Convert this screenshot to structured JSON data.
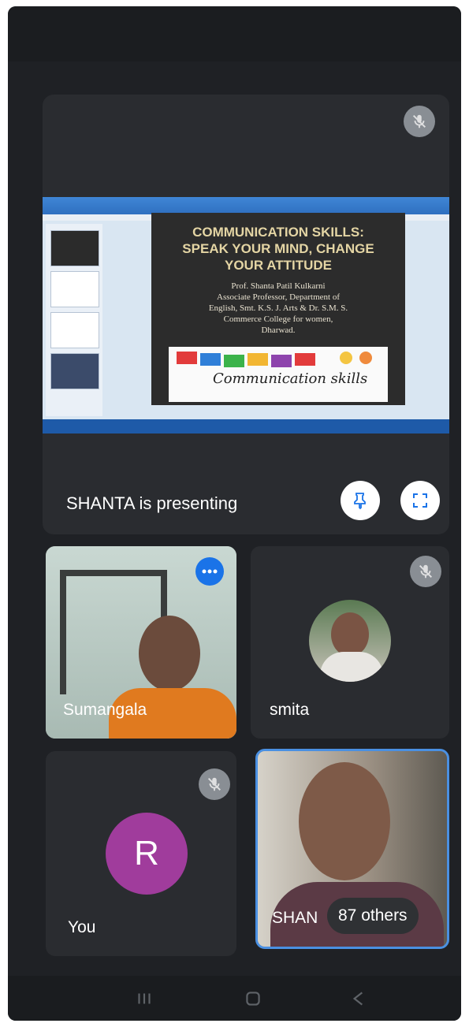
{
  "presentation": {
    "presenting_label": "SHANTA is presenting",
    "slide": {
      "title_line1": "COMMUNICATION SKILLS:",
      "title_line2": "SPEAK YOUR MIND, CHANGE",
      "title_line3": "YOUR ATTITUDE",
      "author": "Prof. Shanta Patil Kulkarni",
      "line1": "Associate Professor, Department of",
      "line2": "English, Smt. K.S. J. Arts & Dr. S.M. S.",
      "line3": "Commerce College for women,",
      "line4": "Dharwad.",
      "image_caption": "Communication skills"
    }
  },
  "participants": {
    "sumangala": {
      "name": "Sumangala"
    },
    "smita": {
      "name": "smita"
    },
    "you": {
      "name": "You",
      "initial": "R"
    },
    "shanta": {
      "name": "SHAN",
      "others_label": "87 others"
    }
  },
  "colors": {
    "background": "#1f2125",
    "tile": "#2a2c30",
    "accent_blue": "#1a73e8",
    "avatar_purple": "#a03c9c",
    "active_border": "#4a90e2"
  },
  "icons": {
    "mic_off": "mic-off-icon",
    "pin": "pin-icon",
    "fullscreen": "fullscreen-icon",
    "speaking": "speaking-dots-icon"
  }
}
